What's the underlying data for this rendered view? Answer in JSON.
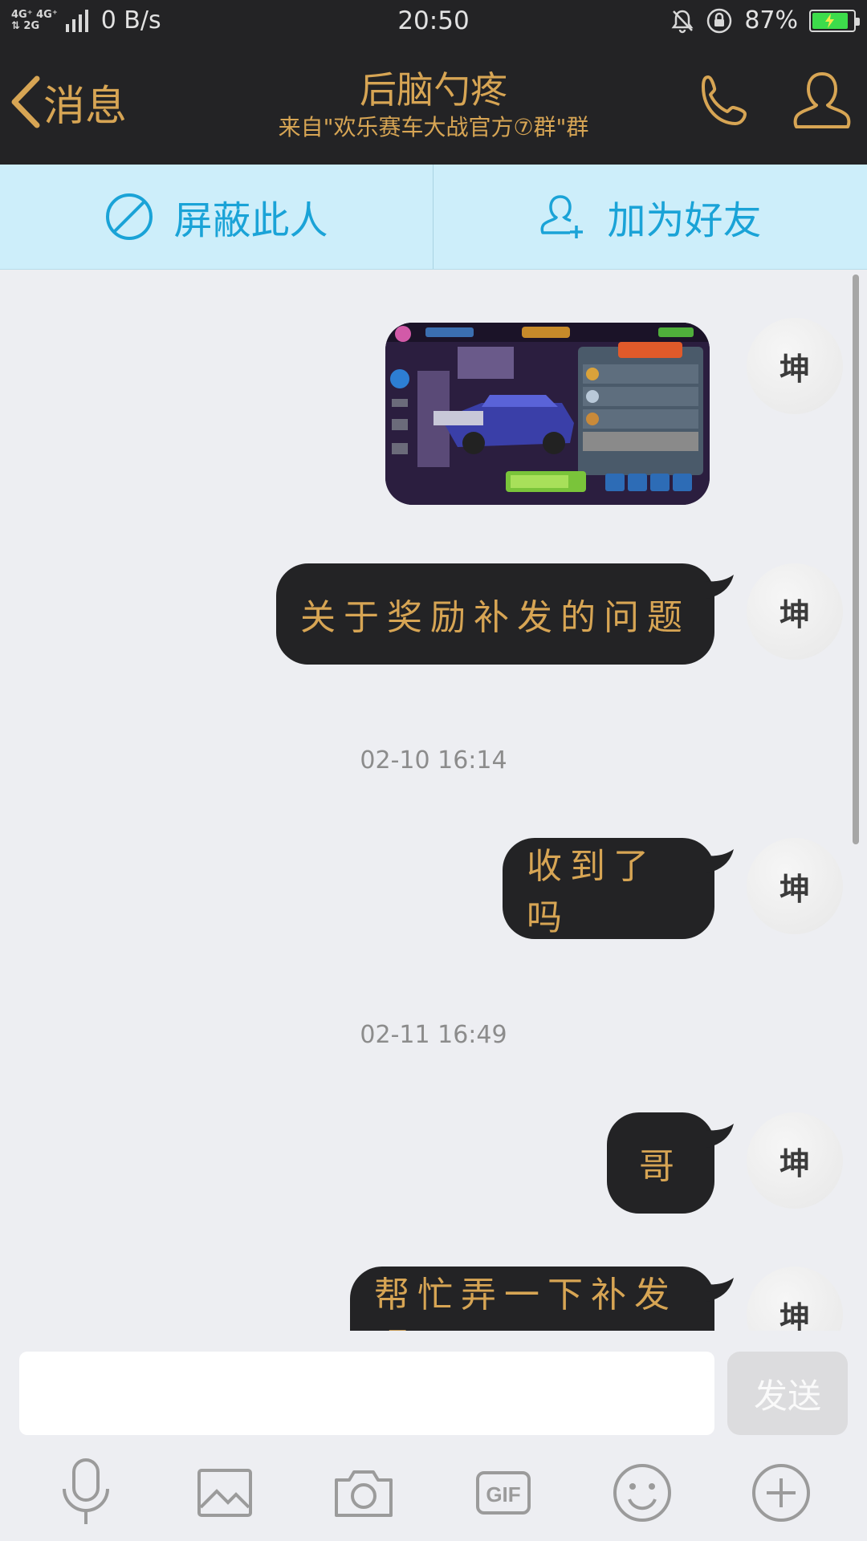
{
  "status_bar": {
    "network_top": "4G⁺ 4G⁺",
    "network_bottom": "⇅ 2G",
    "speed": "0 B/s",
    "time": "20:50",
    "battery_percent": "87%",
    "battery_level": 0.87,
    "icons": [
      "mute-bell-icon",
      "rotation-lock-icon",
      "battery-charging-icon"
    ]
  },
  "nav": {
    "back_label": "消息",
    "title": "后脑勺疼",
    "subtitle": "来自\"欢乐赛车大战官方⑦群\"群",
    "icons": [
      "phone-icon",
      "profile-icon"
    ]
  },
  "actions": {
    "block_label": "屏蔽此人",
    "add_friend_label": "加为好友"
  },
  "messages": [
    {
      "type": "image",
      "avatar": "坤"
    },
    {
      "type": "text",
      "text": "关于奖励补发的问题",
      "avatar": "坤"
    },
    {
      "type": "timestamp",
      "text": "02-10 16:14"
    },
    {
      "type": "text",
      "text": "收到了吗",
      "avatar": "坤"
    },
    {
      "type": "timestamp",
      "text": "02-11 16:49"
    },
    {
      "type": "text",
      "text": "哥",
      "avatar": "坤"
    },
    {
      "type": "text",
      "text": "帮忙弄一下补发呗",
      "avatar": "坤"
    }
  ],
  "input": {
    "value": "",
    "send_label": "发送"
  },
  "toolbar": {
    "items": [
      "microphone-icon",
      "image-icon",
      "camera-icon",
      "gif-icon",
      "emoji-icon",
      "plus-icon"
    ],
    "gif_label": "GIF"
  },
  "colors": {
    "bar_bg": "#232325",
    "gold": "#d7a554",
    "action_bg": "#cdeefa",
    "action_blue": "#1aa3d7",
    "chat_bg": "#edeef2"
  }
}
